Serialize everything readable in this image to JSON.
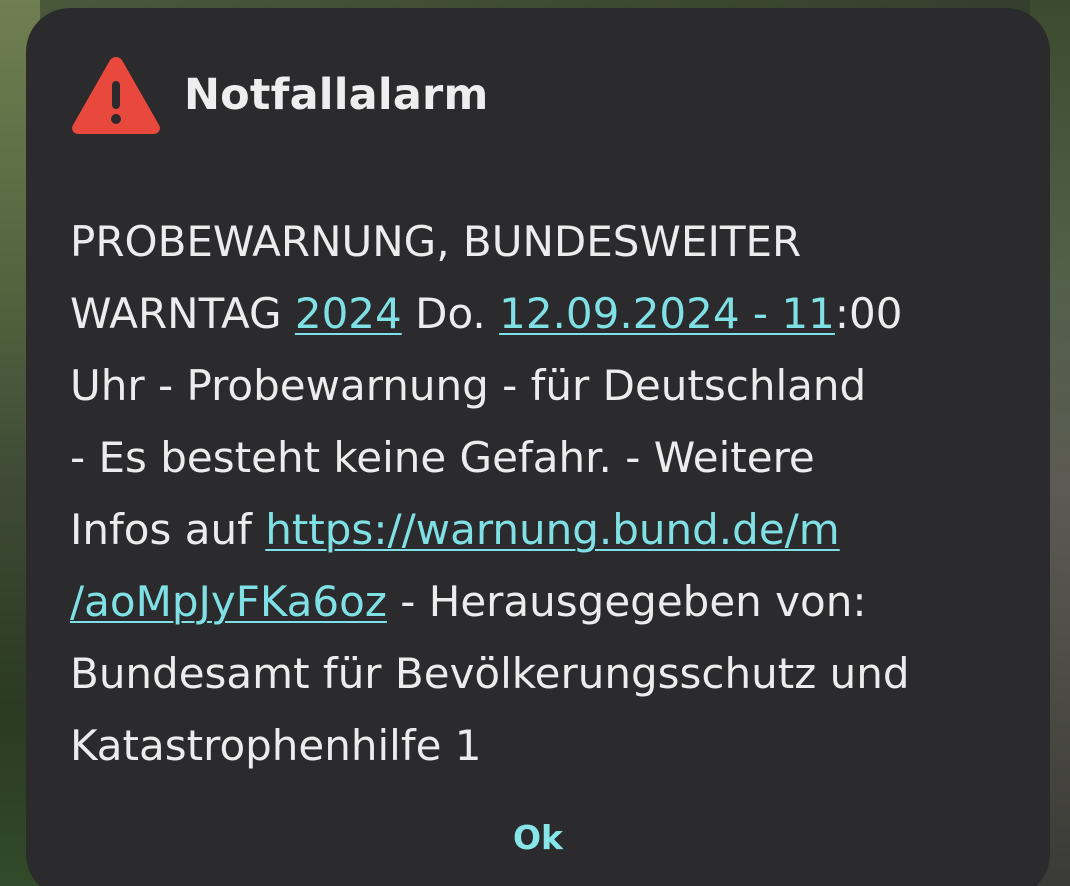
{
  "dialog": {
    "title": "Notfallalarm",
    "icon": "warning-triangle-icon",
    "icon_color": "#e8493c",
    "message": {
      "line1": "PROBEWARNUNG, BUNDESWEITER",
      "line2_a": "WARNTAG ",
      "line2_link1": "2024",
      "line2_b": " Do. ",
      "line2_link2": "12.09.2024 - 11",
      "line2_c": ":00",
      "line3": "Uhr - Probewarnung - für Deutschland",
      "line4": "- Es besteht keine Gefahr. - Weitere",
      "line5_a": "Infos auf ",
      "url_part1": "https://warnung.bund.de/m",
      "url_part2": "/aoMpJyFKa6oz",
      "line6_b": " - Herausgegeben von:",
      "line7": "Bundesamt für Bevölkerungsschutz und",
      "line8": "Katastrophenhilfe 1"
    },
    "ok_label": "Ok",
    "link_color": "#7fe0e5"
  }
}
